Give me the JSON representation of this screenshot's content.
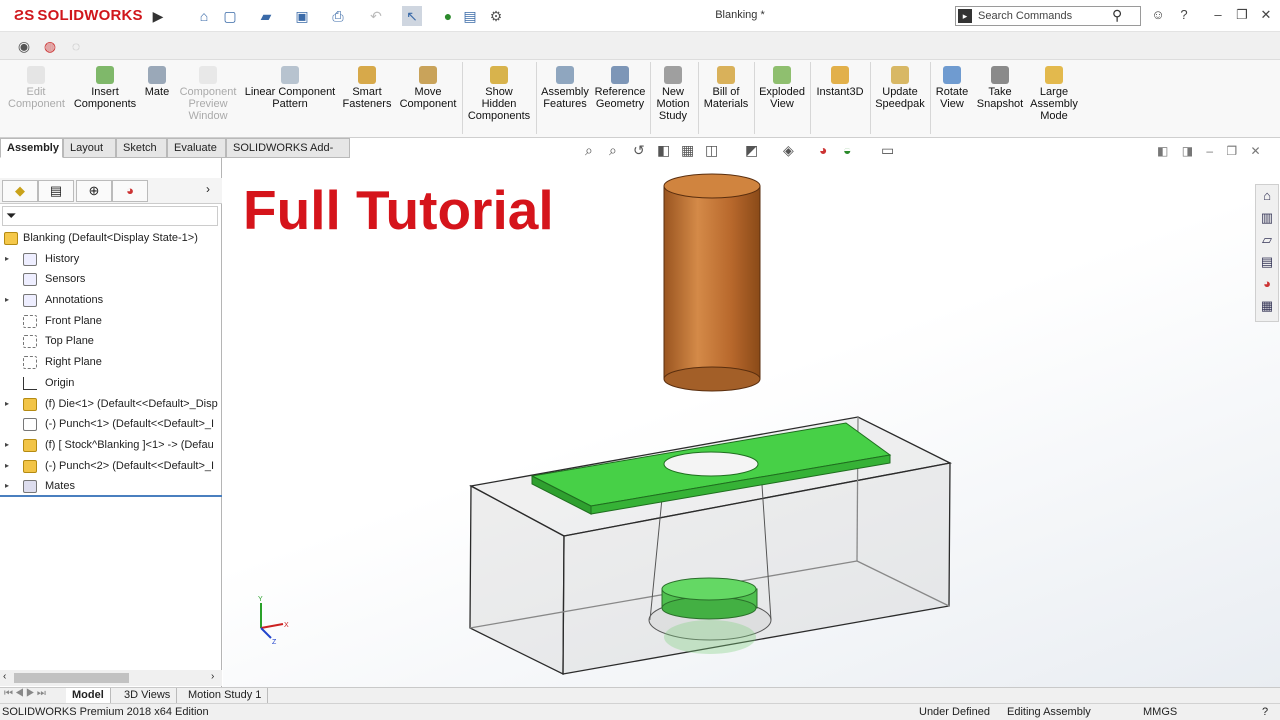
{
  "app": {
    "brand": "SOLIDWORKS",
    "document_title": "Blanking *"
  },
  "search": {
    "placeholder": "Search Commands"
  },
  "ribbon": {
    "buttons": [
      {
        "label": "Edit\nComponent",
        "disabled": true
      },
      {
        "label": "Insert\nComponents"
      },
      {
        "label": "Mate"
      },
      {
        "label": "Component\nPreview\nWindow",
        "disabled": true
      },
      {
        "label": "Linear Component\nPattern"
      },
      {
        "label": "Smart\nFasteners"
      },
      {
        "label": "Move\nComponent"
      },
      {
        "label": "Show\nHidden\nComponents"
      },
      {
        "label": "Assembly\nFeatures"
      },
      {
        "label": "Reference\nGeometry"
      },
      {
        "label": "New\nMotion\nStudy"
      },
      {
        "label": "Bill of\nMaterials"
      },
      {
        "label": "Exploded\nView"
      },
      {
        "label": "Instant3D"
      },
      {
        "label": "Update\nSpeedpak"
      },
      {
        "label": "Rotate\nView"
      },
      {
        "label": "Take\nSnapshot"
      },
      {
        "label": "Large\nAssembly\nMode"
      }
    ]
  },
  "command_tabs": [
    "Assembly",
    "Layout",
    "Sketch",
    "Evaluate",
    "SOLIDWORKS Add-Ins"
  ],
  "tree": {
    "root": "Blanking  (Default<Display State-1>)",
    "items": [
      "History",
      "Sensors",
      "Annotations",
      "Front Plane",
      "Top Plane",
      "Right Plane",
      "Origin",
      "(f) Die<1> (Default<<Default>_Disp",
      "(-) Punch<1> (Default<<Default>_I",
      "(f) [ Stock^Blanking ]<1> -> (Defau",
      "(-) Punch<2> (Default<<Default>_I",
      "Mates"
    ]
  },
  "viewport": {
    "overlay_text": "Full Tutorial"
  },
  "bottom_tabs": [
    "Model",
    "3D Views",
    "Motion Study 1"
  ],
  "status": {
    "edition": "SOLIDWORKS Premium 2018 x64 Edition",
    "state": "Under Defined",
    "mode": "Editing Assembly",
    "units": "MMGS"
  },
  "colors": {
    "brand_red": "#d0171c",
    "headline_red": "#d5141b",
    "punch_brown": "#b86a2c",
    "stock_green": "#3fd13f"
  }
}
